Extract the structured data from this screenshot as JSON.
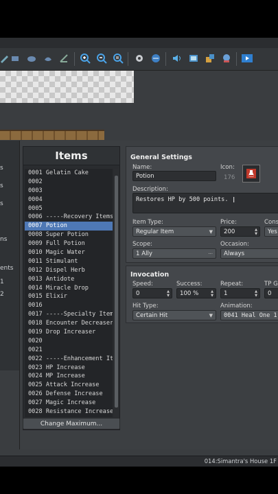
{
  "items_panel": {
    "title": "Items",
    "change_maximum_label": "Change Maximum...",
    "rows": [
      "0001 Gelatin Cake",
      "0002",
      "0003",
      "0004",
      "0005",
      "0006 -----Recovery Items",
      "0007 Potion",
      "0008 Super Potion",
      "0009 Full Potion",
      "0010 Magic Water",
      "0011 Stimulant",
      "0012 Dispel Herb",
      "0013 Antidote",
      "0014 Miracle Drop",
      "0015 Elixir",
      "0016",
      "0017 -----Specialty Items",
      "0018 Encounter Decreaser",
      "0019 Drop Increaser",
      "0020",
      "0021",
      "0022 -----Enhancement It…",
      "0023 HP Increase",
      "0024 MP Increase",
      "0025 Attack Increase",
      "0026 Defense Increase",
      "0027 Magic Increase",
      "0028 Resistance Increase"
    ],
    "selected_index": 6
  },
  "tree": [
    "s",
    "s",
    "s",
    "ns",
    "",
    "ents",
    "1",
    "2"
  ],
  "general": {
    "title": "General Settings",
    "name_label": "Name:",
    "name_value": "Potion",
    "icon_label": "Icon:",
    "icon_index": "176",
    "description_label": "Description:",
    "description_value": "Restores HP by 500 points.",
    "item_type_label": "Item Type:",
    "item_type_value": "Regular Item",
    "price_label": "Price:",
    "price_value": "200",
    "consumable_label": "Cons",
    "consumable_value": "Yes",
    "scope_label": "Scope:",
    "scope_value": "1 Ally",
    "occasion_label": "Occasion:",
    "occasion_value": "Always"
  },
  "invocation": {
    "title": "Invocation",
    "speed_label": "Speed:",
    "speed_value": "0",
    "success_label": "Success:",
    "success_value": "100 %",
    "repeat_label": "Repeat:",
    "repeat_value": "1",
    "tp_label": "TP G",
    "tp_value": "0",
    "hit_type_label": "Hit Type:",
    "hit_type_value": "Certain Hit",
    "animation_label": "Animation:",
    "animation_value": "0041 Heal One 1"
  },
  "status_bar": {
    "map": "014:Simantra's House 1F"
  },
  "colors": {
    "selection": "#4e78b5",
    "background": "#3a3d40",
    "accent_icon": "#c0392b"
  }
}
